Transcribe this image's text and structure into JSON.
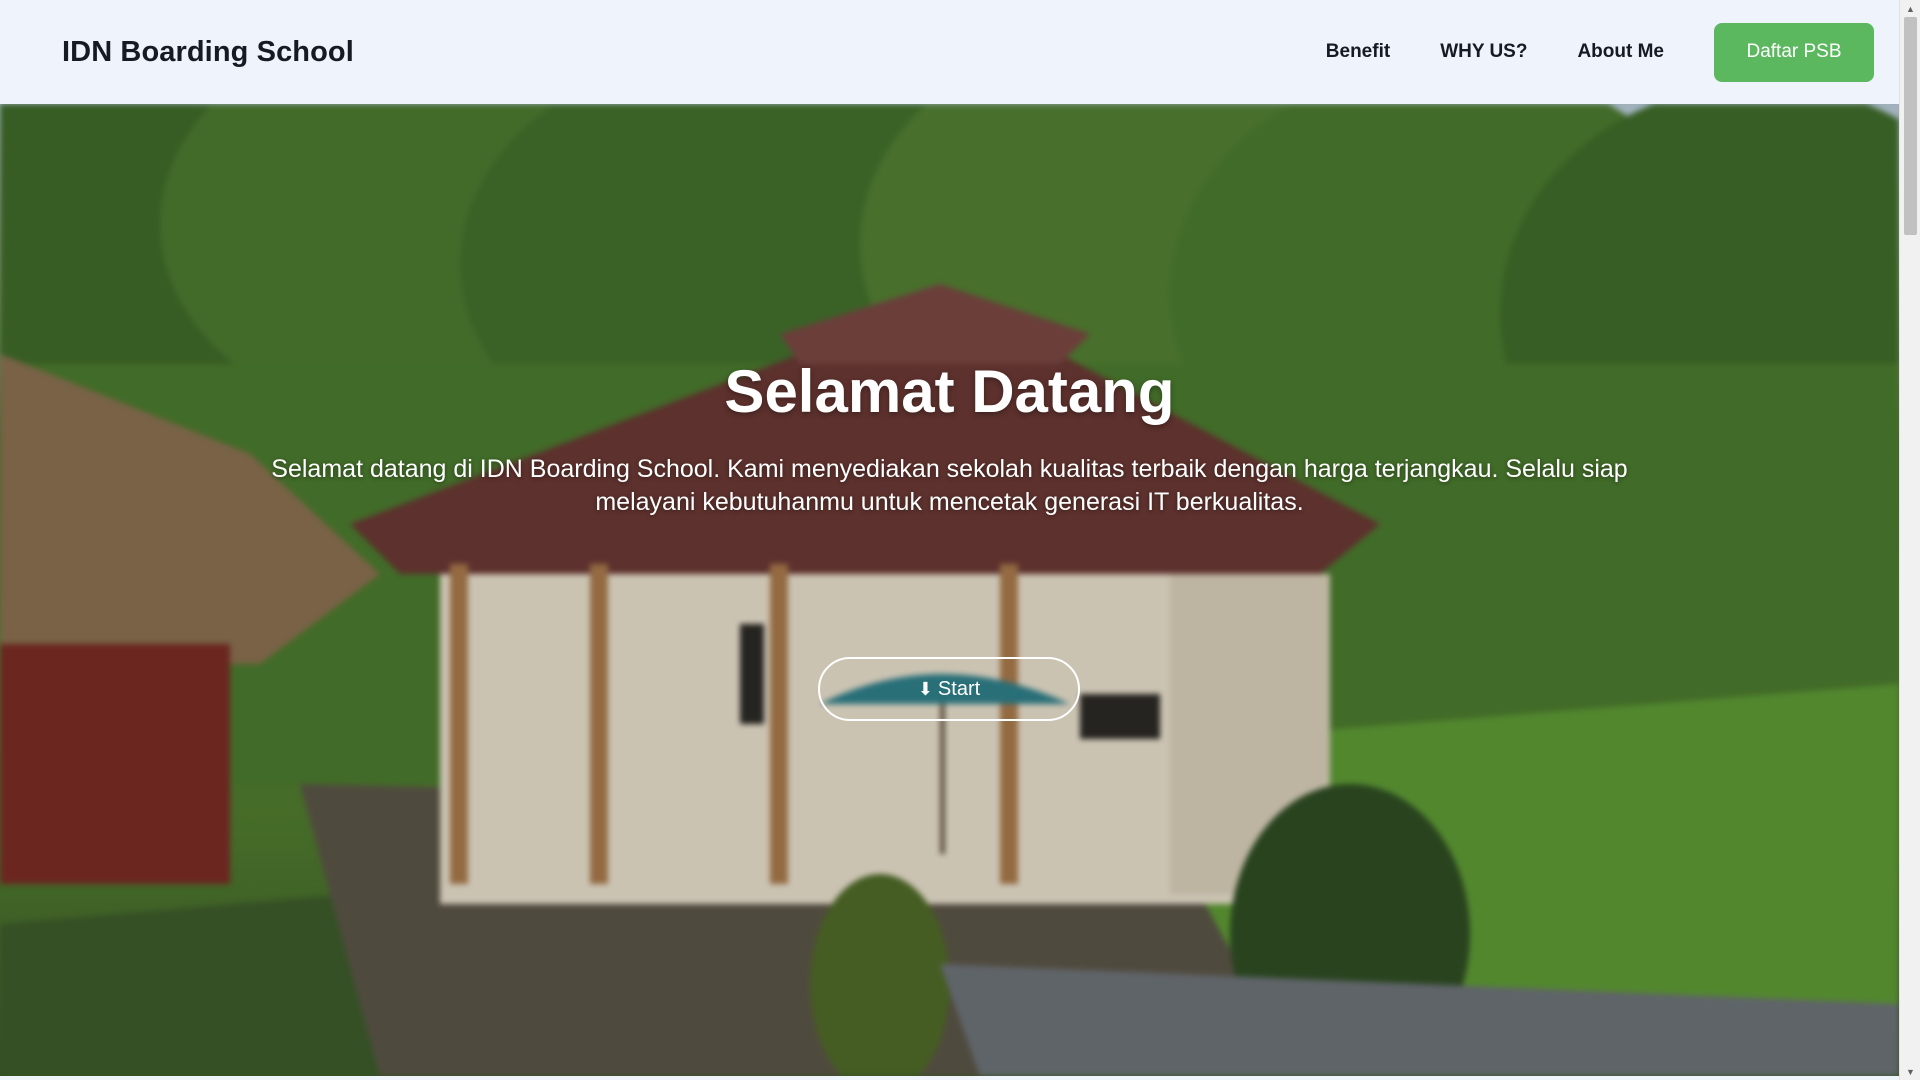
{
  "navbar": {
    "brand": "IDN Boarding School",
    "links": [
      "Benefit",
      "WHY US?",
      "About Me"
    ],
    "cta_label": "Daftar PSB"
  },
  "hero": {
    "title": "Selamat Datang",
    "text": "Selamat datang di IDN Boarding School. Kami menyediakan sekolah kualitas terbaik dengan harga terjangkau. Selalu siap melayani kebutuhanmu untuk mencetak generasi IT berkualitas.",
    "button_arrow": "⬇",
    "button_label": "Start"
  },
  "icons": {
    "scroll_up": "scroll-up-arrow-icon",
    "scroll_down": "scroll-down-arrow-icon",
    "start_arrow": "arrow-down-icon"
  },
  "colors": {
    "navbar_bg": "#eef3fc",
    "cta_bg": "#5cb85f",
    "text_dark": "#161a22",
    "hero_text": "#ffffff"
  }
}
